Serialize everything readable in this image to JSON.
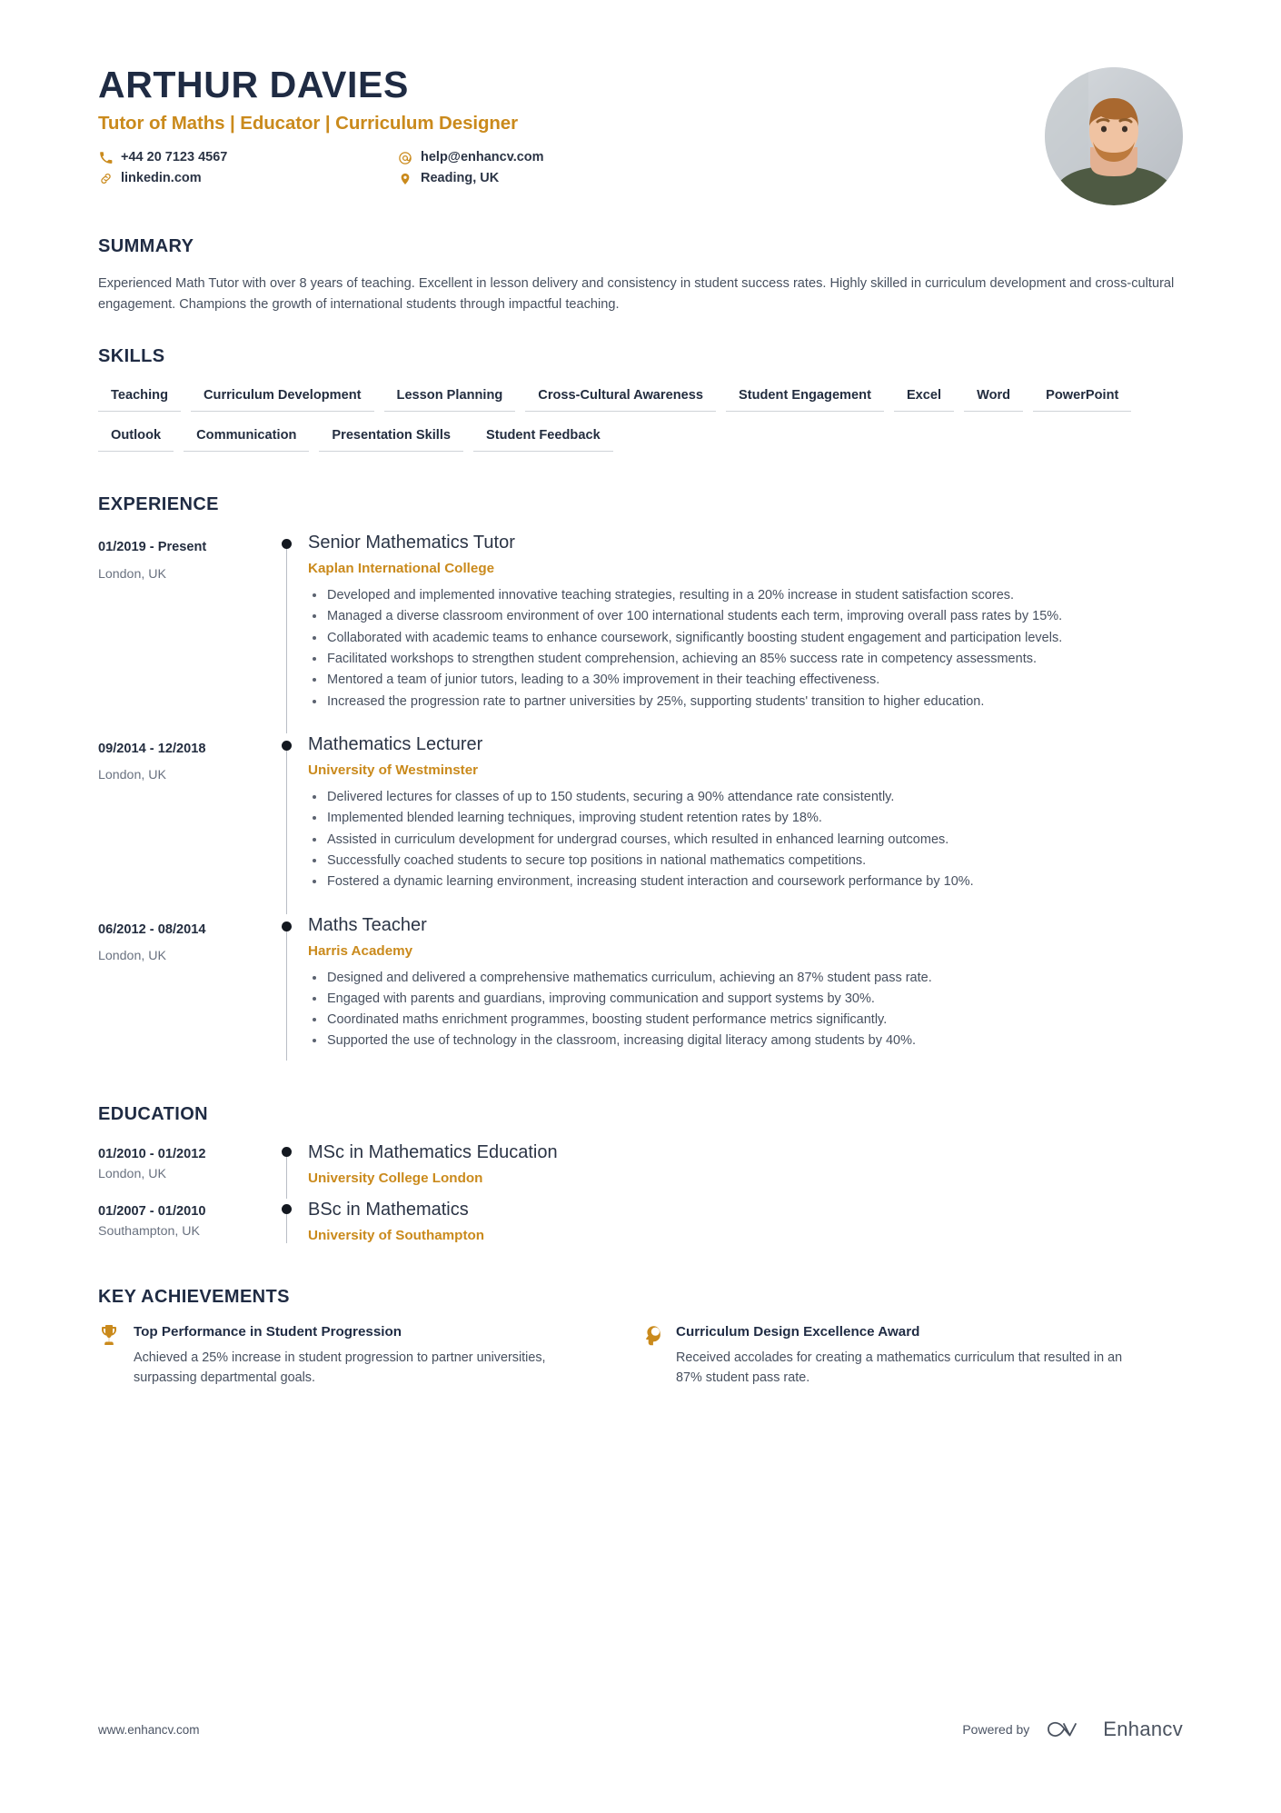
{
  "header": {
    "name": "ARTHUR DAVIES",
    "headline": "Tutor of Maths | Educator | Curriculum Designer",
    "contacts": [
      {
        "icon": "phone-icon",
        "value": "+44 20 7123 4567"
      },
      {
        "icon": "email-icon",
        "value": "help@enhancv.com"
      },
      {
        "icon": "link-icon",
        "value": "linkedin.com"
      },
      {
        "icon": "location-icon",
        "value": "Reading, UK"
      }
    ]
  },
  "summary": {
    "title": "SUMMARY",
    "text": "Experienced Math Tutor with over 8 years of teaching. Excellent in lesson delivery and consistency in student success rates. Highly skilled in curriculum development and cross-cultural engagement. Champions the growth of international students through impactful teaching."
  },
  "skills": {
    "title": "SKILLS",
    "items": [
      "Teaching",
      "Curriculum Development",
      "Lesson Planning",
      "Cross-Cultural Awareness",
      "Student Engagement",
      "Excel",
      "Word",
      "PowerPoint",
      "Outlook",
      "Communication",
      "Presentation Skills",
      "Student Feedback"
    ]
  },
  "experience": {
    "title": "EXPERIENCE",
    "items": [
      {
        "date": "01/2019 - Present",
        "location": "London, UK",
        "title": "Senior Mathematics Tutor",
        "organization": "Kaplan International College",
        "bullets": [
          "Developed and implemented innovative teaching strategies, resulting in a 20% increase in student satisfaction scores.",
          "Managed a diverse classroom environment of over 100 international students each term, improving overall pass rates by 15%.",
          "Collaborated with academic teams to enhance coursework, significantly boosting student engagement and participation levels.",
          "Facilitated workshops to strengthen student comprehension, achieving an 85% success rate in competency assessments.",
          "Mentored a team of junior tutors, leading to a 30% improvement in their teaching effectiveness.",
          "Increased the progression rate to partner universities by 25%, supporting students' transition to higher education."
        ]
      },
      {
        "date": "09/2014 - 12/2018",
        "location": "London, UK",
        "title": "Mathematics Lecturer",
        "organization": "University of Westminster",
        "bullets": [
          "Delivered lectures for classes of up to 150 students, securing a 90% attendance rate consistently.",
          "Implemented blended learning techniques, improving student retention rates by 18%.",
          "Assisted in curriculum development for undergrad courses, which resulted in enhanced learning outcomes.",
          "Successfully coached students to secure top positions in national mathematics competitions.",
          "Fostered a dynamic learning environment, increasing student interaction and coursework performance by 10%."
        ]
      },
      {
        "date": "06/2012 - 08/2014",
        "location": "London, UK",
        "title": "Maths Teacher",
        "organization": "Harris Academy",
        "bullets": [
          "Designed and delivered a comprehensive mathematics curriculum, achieving an 87% student pass rate.",
          "Engaged with parents and guardians, improving communication and support systems by 30%.",
          "Coordinated maths enrichment programmes, boosting student performance metrics significantly.",
          "Supported the use of technology in the classroom, increasing digital literacy among students by 40%."
        ]
      }
    ]
  },
  "education": {
    "title": "EDUCATION",
    "items": [
      {
        "date": "01/2010 - 01/2012",
        "location": "London, UK",
        "degree": "MSc in Mathematics Education",
        "school": "University College London"
      },
      {
        "date": "01/2007 - 01/2010",
        "location": "Southampton, UK",
        "degree": "BSc in Mathematics",
        "school": "University of Southampton"
      }
    ]
  },
  "achievements": {
    "title": "KEY ACHIEVEMENTS",
    "items": [
      {
        "icon": "trophy-icon",
        "title": "Top Performance in Student Progression",
        "description": "Achieved a 25% increase in student progression to partner universities, surpassing departmental goals."
      },
      {
        "icon": "head-profile-icon",
        "title": "Curriculum Design Excellence Award",
        "description": "Received accolades for creating a mathematics curriculum that resulted in an 87% student pass rate."
      }
    ]
  },
  "footer": {
    "url": "www.enhancv.com",
    "powered_by": "Powered by",
    "brand": "Enhancv"
  },
  "colors": {
    "accent": "#ca8a1c",
    "heading": "#1f2b43",
    "body": "#47505f"
  }
}
